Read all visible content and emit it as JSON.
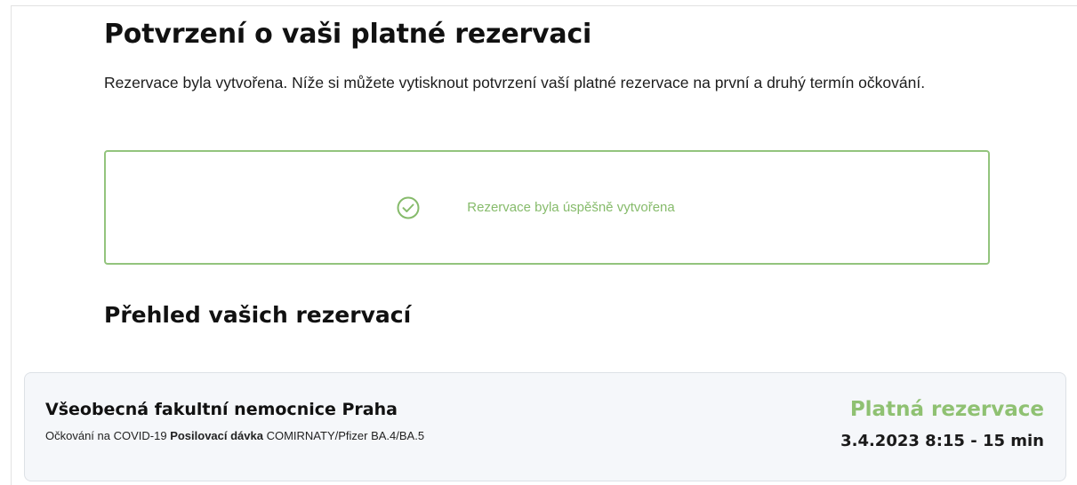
{
  "page": {
    "title": "Potvrzení o vaši platné rezervaci",
    "intro": "Rezervace byla vytvořena. Níže si můžete vytisknout potvrzení vaší platné rezervace na první a druhý termín očkování."
  },
  "success": {
    "icon": "check-circle-icon",
    "message": "Rezervace byla úspěšně vytvořena",
    "color": "#86bb6b"
  },
  "overview": {
    "title": "Přehled vašich rezervací"
  },
  "reservation": {
    "facility": "Všeobecná fakultní nemocnice Praha",
    "vaccination_prefix": "Očkování na COVID-19",
    "dose": "Posilovací dávka",
    "vaccine": "COMIRNATY/Pfizer BA.4/BA.5",
    "status": "Platná rezervace",
    "status_color": "#8fc172",
    "datetime": "3.4.2023 8:15 - 15 min"
  }
}
